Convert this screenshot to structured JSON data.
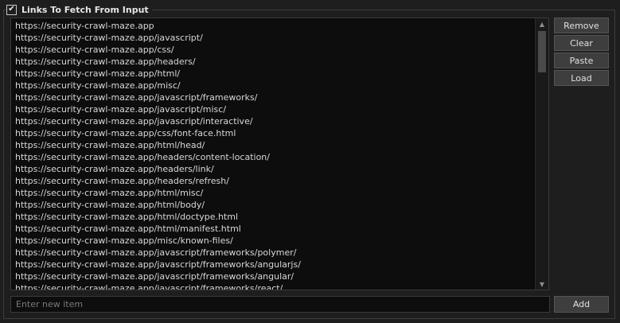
{
  "group": {
    "title": "Links To Fetch From Input",
    "checked": true,
    "check_glyph": "✔"
  },
  "links": [
    "https://security-crawl-maze.app",
    "https://security-crawl-maze.app/javascript/",
    "https://security-crawl-maze.app/css/",
    "https://security-crawl-maze.app/headers/",
    "https://security-crawl-maze.app/html/",
    "https://security-crawl-maze.app/misc/",
    "https://security-crawl-maze.app/javascript/frameworks/",
    "https://security-crawl-maze.app/javascript/misc/",
    "https://security-crawl-maze.app/javascript/interactive/",
    "https://security-crawl-maze.app/css/font-face.html",
    "https://security-crawl-maze.app/html/head/",
    "https://security-crawl-maze.app/headers/content-location/",
    "https://security-crawl-maze.app/headers/link/",
    "https://security-crawl-maze.app/headers/refresh/",
    "https://security-crawl-maze.app/html/misc/",
    "https://security-crawl-maze.app/html/body/",
    "https://security-crawl-maze.app/html/doctype.html",
    "https://security-crawl-maze.app/html/manifest.html",
    "https://security-crawl-maze.app/misc/known-files/",
    "https://security-crawl-maze.app/javascript/frameworks/polymer/",
    "https://security-crawl-maze.app/javascript/frameworks/angularjs/",
    "https://security-crawl-maze.app/javascript/frameworks/angular/",
    "https://security-crawl-maze.app/javascript/frameworks/react/"
  ],
  "buttons": {
    "remove": "Remove",
    "clear": "Clear",
    "paste": "Paste",
    "load": "Load",
    "add": "Add"
  },
  "new_item": {
    "placeholder": "Enter new item",
    "value": ""
  },
  "icons": {
    "scroll_up": "▲",
    "scroll_down": "▼"
  }
}
